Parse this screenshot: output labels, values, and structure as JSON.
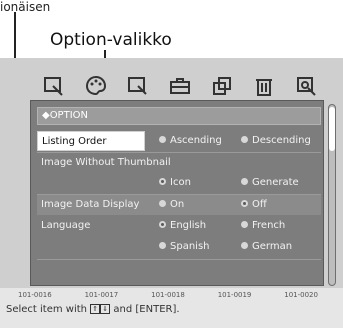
{
  "callout": {
    "top_label": "ionäisen",
    "title": "Option-valikko"
  },
  "menu": {
    "header": "◆OPTION",
    "rows": [
      {
        "label": "Listing Order",
        "options": [
          "Ascending",
          "Descending"
        ],
        "selected": null
      },
      {
        "label": "Image Without Thumbnail",
        "options": [],
        "selected": null
      },
      {
        "label": "",
        "options": [
          "Icon",
          "Generate"
        ],
        "selected": 0
      },
      {
        "label": "Image Data Display",
        "options": [
          "On",
          "Off"
        ],
        "selected": 1
      },
      {
        "label": "Language",
        "options": [
          "English",
          "French"
        ],
        "selected": 0
      },
      {
        "label": "",
        "options": [
          "Spanish",
          "German"
        ],
        "selected": null
      }
    ]
  },
  "thumbnails": [
    "101-0016",
    "101-0017",
    "101-0018",
    "101-0019",
    "101-0020"
  ],
  "hint": {
    "prefix": "Select item with",
    "keys": [
      "⇑",
      "⇓"
    ],
    "suffix": "and [ENTER]."
  },
  "toolbar_icons": [
    "view-mode-icon",
    "palette-icon",
    "search-icon",
    "toolbox-icon",
    "copy-icon",
    "trash-icon",
    "zoom-icon"
  ],
  "colors": {
    "panel": "#7d7d7d",
    "panel_header": "#9c9c9c",
    "highlight": "#ffffff"
  }
}
